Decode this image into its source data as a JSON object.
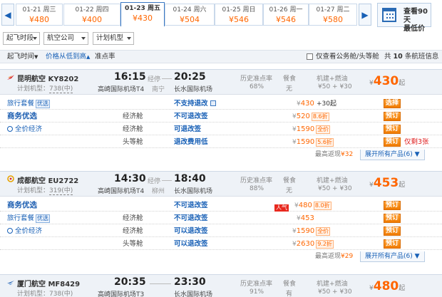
{
  "dates": [
    {
      "date": "01-21 周三",
      "price": "¥480"
    },
    {
      "date": "01-22 周四",
      "price": "¥400"
    },
    {
      "date": "01-23 周五",
      "price": "¥430"
    },
    {
      "date": "01-24 周六",
      "price": "¥504"
    },
    {
      "date": "01-25 周日",
      "price": "¥546"
    },
    {
      "date": "01-26 周一",
      "price": "¥546"
    },
    {
      "date": "01-27 周二",
      "price": "¥580"
    }
  ],
  "calendar": {
    "line1": "查看90天",
    "line2": "最低价"
  },
  "nav": {
    "prev": "◀",
    "next": "▶"
  },
  "filters": [
    "起飞时段",
    "航空公司",
    "计划机型"
  ],
  "sort": {
    "depart": "起飞时间",
    "price": "价格从低到高",
    "punct": "准点率",
    "checkbox_label": "仅查看公务舱/头等舱",
    "summary_pre": "共",
    "summary_num": "10",
    "summary_post": "条航班信息",
    "arrow_down": "▼",
    "arrow_up": "▲"
  },
  "common": {
    "plan_label": "计划机型：",
    "via_prefix": "经停",
    "hist_label": "历史准点率",
    "meal_label": "餐食",
    "tax_label": "机建+燃油",
    "tax_value": "¥50 + ¥30",
    "qi": "起",
    "cur": "¥",
    "select": "选择",
    "book": "预订",
    "lowest_label": "最高返现",
    "expand_label": "展开所有产品(6)",
    "expand_arrow": "▼"
  },
  "flights": [
    {
      "airline": "昆明航空 KY8202",
      "plane": "738(中)",
      "dep_time": "16:15",
      "dep_airport": "高崎国际机场T4",
      "via": "南宁",
      "arr_time": "20:25",
      "arr_airport": "长水国际机场",
      "punct": "68%",
      "meal": "无",
      "price": "430",
      "products": [
        {
          "label": "旅行套餐",
          "tag": "优选",
          "cabin": "",
          "rule": "不支持退改",
          "price": "430",
          "extra": "+30起",
          "disc": "",
          "btn": "选择",
          "note": ""
        },
        {
          "label": "商务优选",
          "tag": "",
          "cabin": "经济舱",
          "rule": "不可退改签",
          "price": "520",
          "extra": "",
          "disc": "8.6折",
          "btn": "预订",
          "note": ""
        },
        {
          "label": "全价经济",
          "tag": "",
          "cabin": "经济舱",
          "rule": "可退改签",
          "price": "1590",
          "extra": "",
          "disc": "全价",
          "btn": "预订",
          "note": ""
        },
        {
          "label": "",
          "tag": "",
          "cabin": "头等舱",
          "rule": "退改费用低",
          "price": "1590",
          "extra": "",
          "disc": "5.6折",
          "btn": "预订",
          "note": "仅剩3张"
        }
      ],
      "cashback": "¥32"
    },
    {
      "airline": "成都航空 EU2722",
      "plane": "319(中)",
      "dep_time": "14:30",
      "dep_airport": "高崎国际机场T4",
      "via": "柳州",
      "arr_time": "18:40",
      "arr_airport": "长水国际机场",
      "punct": "88%",
      "meal": "无",
      "price": "453",
      "products": [
        {
          "label": "商务优选",
          "tag": "",
          "cabin": "",
          "rule": "不可退改签",
          "price": "480",
          "extra": "",
          "disc": "8.0折",
          "btn": "预订",
          "note": "",
          "hot": "人气"
        },
        {
          "label": "旅行套餐",
          "tag": "优选",
          "cabin": "经济舱",
          "rule": "不可退改签",
          "price": "453",
          "extra": "",
          "disc": "",
          "btn": "预订",
          "note": ""
        },
        {
          "label": "全价经济",
          "tag": "",
          "cabin": "经济舱",
          "rule": "可以退改签",
          "price": "1590",
          "extra": "",
          "disc": "全价",
          "btn": "预订",
          "note": ""
        },
        {
          "label": "",
          "tag": "",
          "cabin": "头等舱",
          "rule": "可以退改签",
          "price": "2630",
          "extra": "",
          "disc": "9.2折",
          "btn": "预订",
          "note": ""
        }
      ],
      "cashback": "¥29"
    },
    {
      "airline": "厦门航空 MF8429",
      "plane": "738(中)",
      "dep_time": "20:35",
      "dep_airport": "高崎国际机场T3",
      "arr_time": "23:30",
      "arr_airport": "长水国际机场",
      "punct": "91%",
      "meal": "有",
      "price": "480"
    }
  ]
}
